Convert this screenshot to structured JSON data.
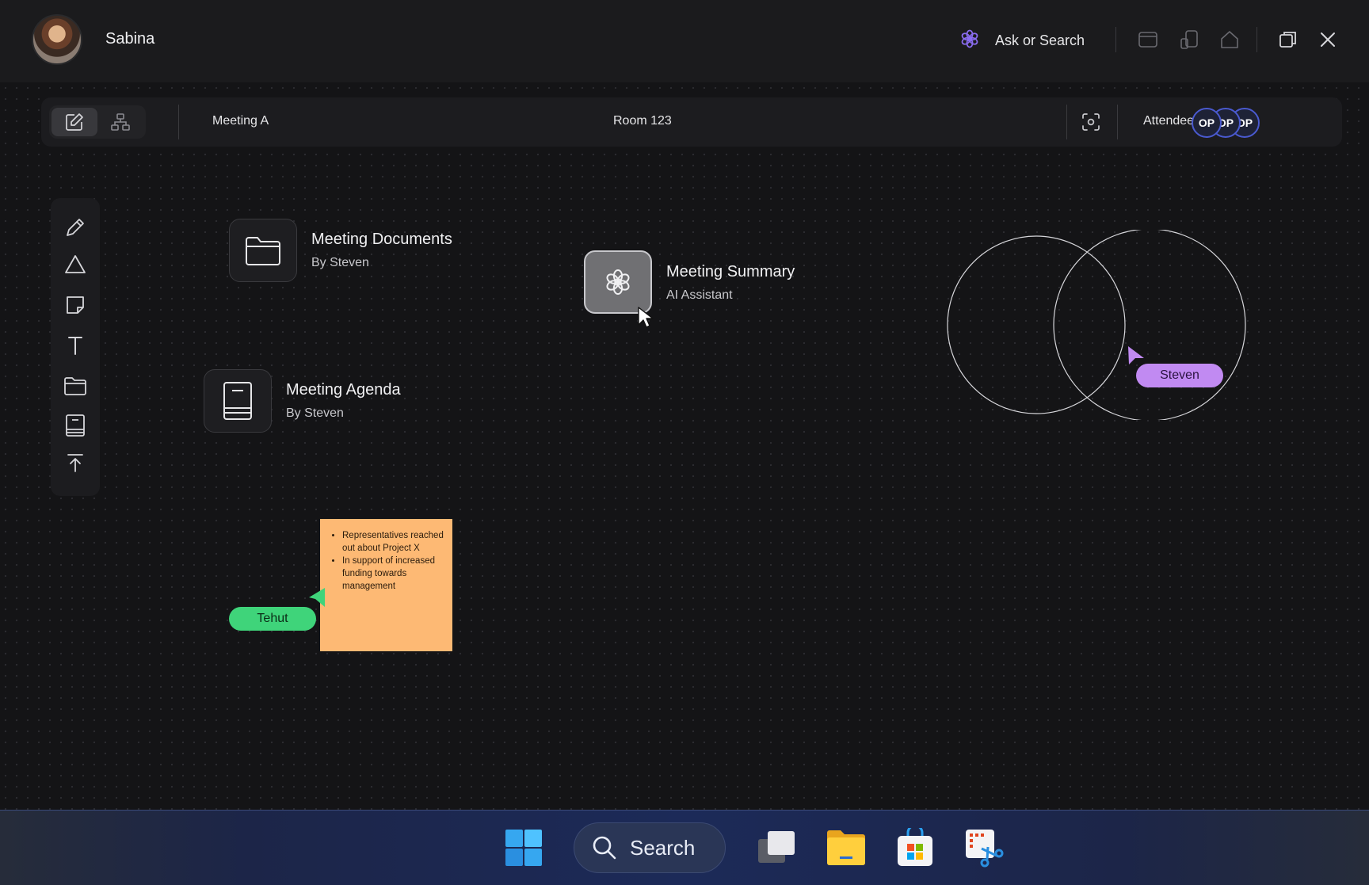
{
  "user": {
    "name": "Sabina"
  },
  "header": {
    "ask_label": "Ask or Search"
  },
  "meeting": {
    "name": "Meeting A",
    "room": "Room 123",
    "attendees_label": "Attendees",
    "attendees": [
      "OP",
      "OP",
      "OP"
    ]
  },
  "cards": [
    {
      "title": "Meeting Documents",
      "subtitle": "By Steven",
      "icon": "folder-icon"
    },
    {
      "title": "Meeting Summary",
      "subtitle": "AI Assistant",
      "icon": "ai-flower-icon"
    },
    {
      "title": "Meeting Agenda",
      "subtitle": "By Steven",
      "icon": "book-icon"
    }
  ],
  "sticky_note": {
    "items": [
      "Representatives reached out about Project X",
      "In support of increased funding towards management"
    ]
  },
  "cursors": [
    {
      "name": "Tehut",
      "color": "#3fd47a"
    },
    {
      "name": "Steven",
      "color": "#c18af2"
    }
  ],
  "taskbar": {
    "search_label": "Search",
    "apps": [
      "windows-start-icon",
      "task-view-icon",
      "file-explorer-icon",
      "microsoft-store-icon",
      "snipping-tool-icon"
    ]
  },
  "colors": {
    "background": "#141416",
    "accent_purple": "#8a6cf0",
    "sticky": "#fdb974"
  }
}
